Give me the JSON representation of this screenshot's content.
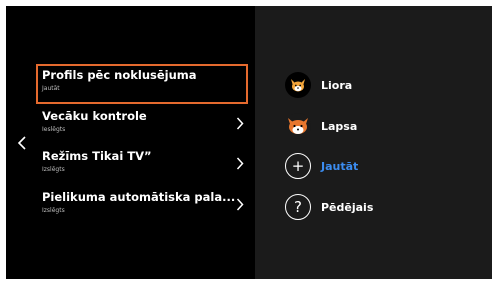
{
  "settings": {
    "items": [
      {
        "title": "Profils pēc noklusējuma",
        "subtitle": "Jautāt",
        "selected": true
      },
      {
        "title": "Vecāku kontrole",
        "subtitle": "Ieslēgts"
      },
      {
        "title": "Režīms Tikai TV”",
        "subtitle": "Izslēgts"
      },
      {
        "title": "Pielikuma automātiska pala...",
        "subtitle": "Izslēgts"
      }
    ]
  },
  "profiles": [
    {
      "name": "Liora",
      "icon": "fox-avatar-icon"
    },
    {
      "name": "Lapsa",
      "icon": "fox-avatar-icon"
    },
    {
      "name": "Jautāt",
      "icon": "plus-icon",
      "highlight_color": "#3b8cf0"
    },
    {
      "name": "Pēdējais",
      "icon": "question-mark-icon"
    }
  ],
  "icons": {
    "plus": "+",
    "question": "?"
  },
  "colors": {
    "focus_border": "#e56a2e",
    "accent_blue": "#3b8cf0",
    "left_panel": "#000000",
    "right_panel": "#1b1b1b"
  }
}
